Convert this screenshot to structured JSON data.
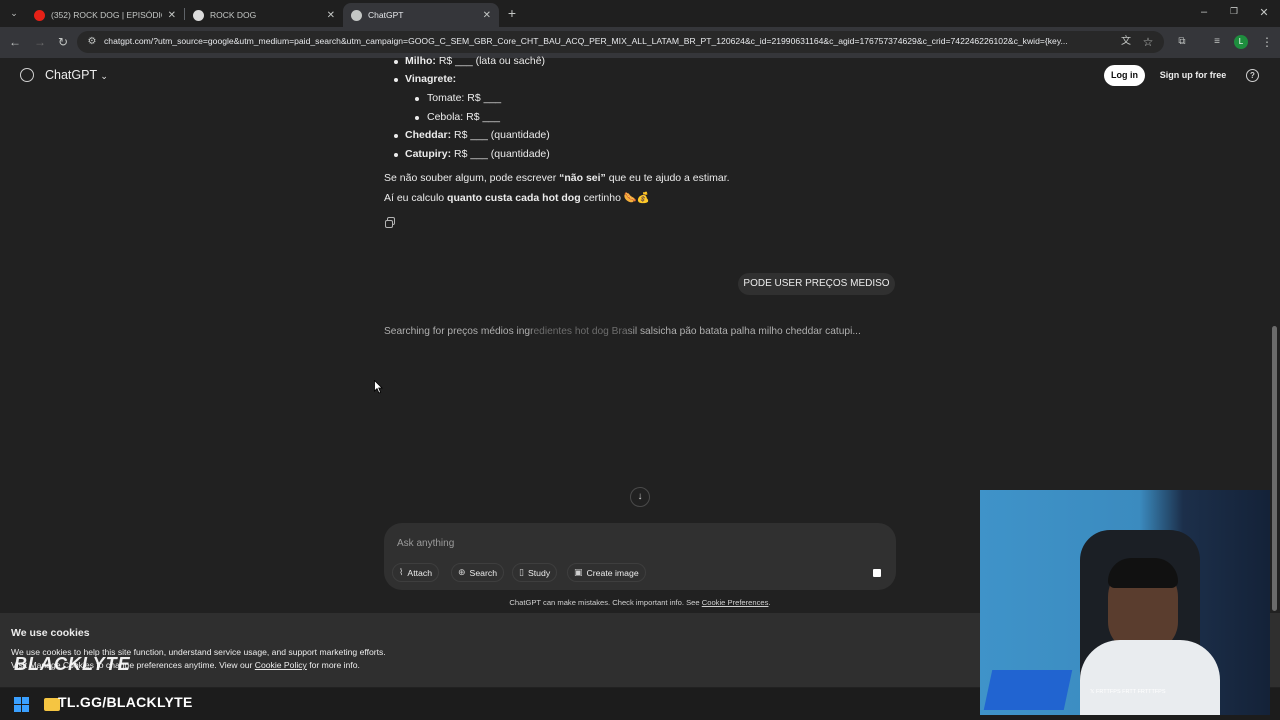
{
  "browser": {
    "tabs": [
      {
        "title": "(352) ROCK DOG | EPISÓDIO C...",
        "favicon": "youtube-icon"
      },
      {
        "title": "ROCK DOG",
        "favicon": "globe-icon"
      },
      {
        "title": "ChatGPT",
        "favicon": "chatgpt-icon"
      }
    ],
    "url": "chatgpt.com/?utm_source=google&utm_medium=paid_search&utm_campaign=GOOG_C_SEM_GBR_Core_CHT_BAU_ACQ_PER_MIX_ALL_LATAM_BR_PT_120624&c_id=21990631164&c_agid=176757374629&c_crid=742246226102&c_kwid={key..."
  },
  "header": {
    "brand": "ChatGPT",
    "login_label": "Log in",
    "signup_label": "Sign up for free"
  },
  "message": {
    "milho_label": "Milho:",
    "milho_text": "R$ ___ (lata ou sachê)",
    "vinagrete_label": "Vinagrete:",
    "tomate_text": "Tomate: R$ ___",
    "cebola_text": "Cebola: R$ ___",
    "cheddar_label": "Cheddar:",
    "cheddar_text": "R$ ___ (quantidade)",
    "catupiry_label": "Catupiry:",
    "catupiry_text": "R$ ___ (quantidade)",
    "p1_a": "Se não souber algum, pode escrever",
    "p1_b": "“não sei”",
    "p1_c": "que eu te ajudo a estimar.",
    "p2_a": "Aí eu calculo",
    "p2_b": "quanto custa cada hot dog",
    "p2_c": "certinho 🌭💰"
  },
  "user_message": "PODE USER PREÇOS MEDISO",
  "searching": "Searching for preços médios ingredientes hot dog Brasil salsicha pão batata palha milho cheddar catupi...",
  "composer": {
    "placeholder": "Ask anything",
    "attach": "Attach",
    "search": "Search",
    "study": "Study",
    "create_image": "Create image"
  },
  "disclaimer": {
    "text": "ChatGPT can make mistakes. Check important info. See",
    "link": "Cookie Preferences",
    "end": "."
  },
  "cookie": {
    "title": "We use cookies",
    "line1": "We use cookies to help this site function, understand service usage, and support marketing efforts.",
    "line2_a": "Visit Manage Cookies to change preferences anytime. View our",
    "line2_link": "Cookie Policy",
    "line2_b": "for more info."
  },
  "overlay": {
    "logo_text": "BLACKLYTE",
    "promo": "TL.GG/BLACKLYTE",
    "webcam_socials": "𝕏 FRTTFPS   FRTT   FRTTTFPS"
  },
  "colors": {
    "background": "#212121",
    "composer": "#303030",
    "accent_green": "#1e8e3e"
  }
}
